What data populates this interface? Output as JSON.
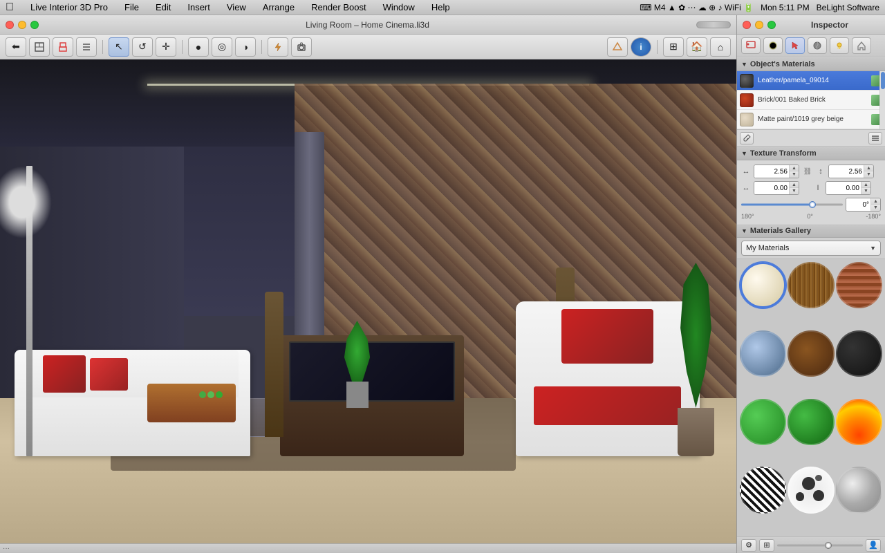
{
  "app": {
    "name": "Live Interior 3D Pro",
    "menu": {
      "apple": "⌘",
      "items": [
        "Live Interior 3D Pro",
        "File",
        "Edit",
        "Insert",
        "View",
        "Arrange",
        "Render Boost",
        "Window",
        "Help"
      ]
    },
    "right_menu": {
      "time": "Mon 5:11 PM",
      "brand": "BeLight Software"
    }
  },
  "window": {
    "title": "Living Room – Home Cinema.li3d",
    "traffic_lights": [
      "close",
      "minimize",
      "maximize"
    ]
  },
  "inspector": {
    "title": "Inspector",
    "tabs": [
      "paintbrush",
      "sphere",
      "cursor",
      "texture",
      "light",
      "house"
    ],
    "sections": {
      "objects_materials": {
        "label": "Object's Materials",
        "materials": [
          {
            "name": "Leather/pamela_09014",
            "swatch_type": "dark-leather",
            "selected": true
          },
          {
            "name": "Brick/001 Baked Brick",
            "swatch_type": "brick-red",
            "selected": false
          },
          {
            "name": "Matte paint/1019 grey beige",
            "swatch_type": "cream-matte",
            "selected": false
          }
        ]
      },
      "texture_transform": {
        "label": "Texture Transform",
        "width": "2.56",
        "height": "2.56",
        "offset_x": "0.00",
        "offset_y": "0.00",
        "rotation": "0°",
        "rotation_min": "180°",
        "rotation_mid": "0°",
        "rotation_max": "-180°"
      },
      "materials_gallery": {
        "label": "Materials Gallery",
        "dropdown_value": "My Materials",
        "items": [
          {
            "type": "cream",
            "selected": true
          },
          {
            "type": "wood1"
          },
          {
            "type": "brick"
          },
          {
            "type": "water"
          },
          {
            "type": "wood2"
          },
          {
            "type": "dark"
          },
          {
            "type": "green"
          },
          {
            "type": "green2"
          },
          {
            "type": "fire"
          },
          {
            "type": "zebra"
          },
          {
            "type": "spots"
          },
          {
            "type": "metal"
          }
        ]
      }
    }
  },
  "toolbar": {
    "buttons": [
      "↩",
      "⊡",
      "🖨",
      "≡",
      "|",
      "↖",
      "↺",
      "✛",
      "|",
      "●",
      "◎",
      "◑",
      "|",
      "⚡",
      "📷",
      "|",
      "🔲",
      "🏠",
      "🏠"
    ],
    "right_buttons": [
      "🎮",
      "ℹ",
      "⊞",
      "⊟",
      "⌂"
    ]
  }
}
